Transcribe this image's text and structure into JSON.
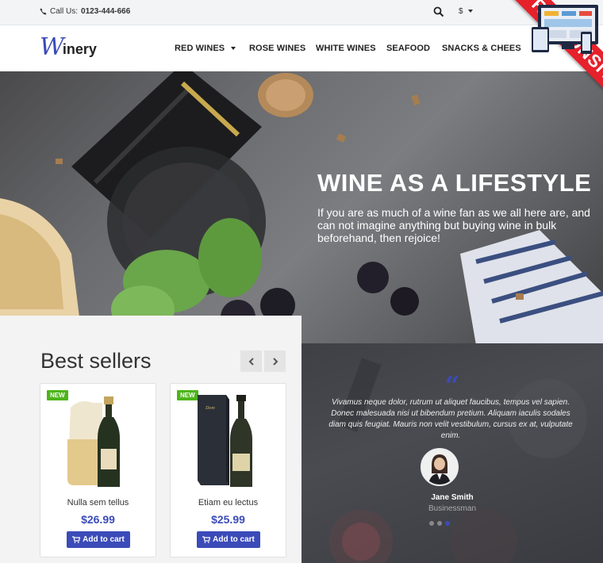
{
  "topbar": {
    "call_prefix": "Call Us:",
    "phone": "0123-444-666",
    "currency": "$"
  },
  "brand": {
    "logo_mark": "W",
    "logo_rest": "inery"
  },
  "nav": {
    "items": [
      "RED WINES",
      "ROSE WINES",
      "WHITE WINES",
      "SEAFOOD",
      "SNACKS & CHEES"
    ]
  },
  "ribbon": {
    "label": "RESPONSIVE"
  },
  "hero": {
    "title": "WINE AS A LIFESTYLE",
    "subtitle": "If you are as much of a wine fan as we all here are, and can not imagine anything but buying wine in bulk beforehand, then rejoice!"
  },
  "best_sellers": {
    "heading": "Best sellers",
    "products": [
      {
        "badge": "NEW",
        "name": "Nulla sem tellus",
        "price": "$26.99",
        "cart_label": "Add to cart"
      },
      {
        "badge": "NEW",
        "name": "Etiam eu lectus",
        "price": "$25.99",
        "cart_label": "Add to cart"
      }
    ]
  },
  "testimonial": {
    "quote_mark": "“",
    "text": "Vivamus neque dolor, rutrum ut aliquet faucibus, tempus vel sapien. Donec malesuada nisi ut bibendum pretium. Aliquam iaculis sodales diam quis feugiat. Mauris non velit vestibulum, cursus ex at, vulputate enim.",
    "name": "Jane Smith",
    "role": "Businessman",
    "active_slide": 3,
    "slide_count": 3
  },
  "colors": {
    "accent": "#3b4bb8",
    "badge_green": "#4cb51a",
    "ribbon_red": "#e5212b"
  },
  "icons": [
    "phone-icon",
    "search-icon",
    "chevron-down-icon",
    "chevron-left-icon",
    "chevron-right-icon",
    "cart-icon",
    "quote-icon"
  ]
}
